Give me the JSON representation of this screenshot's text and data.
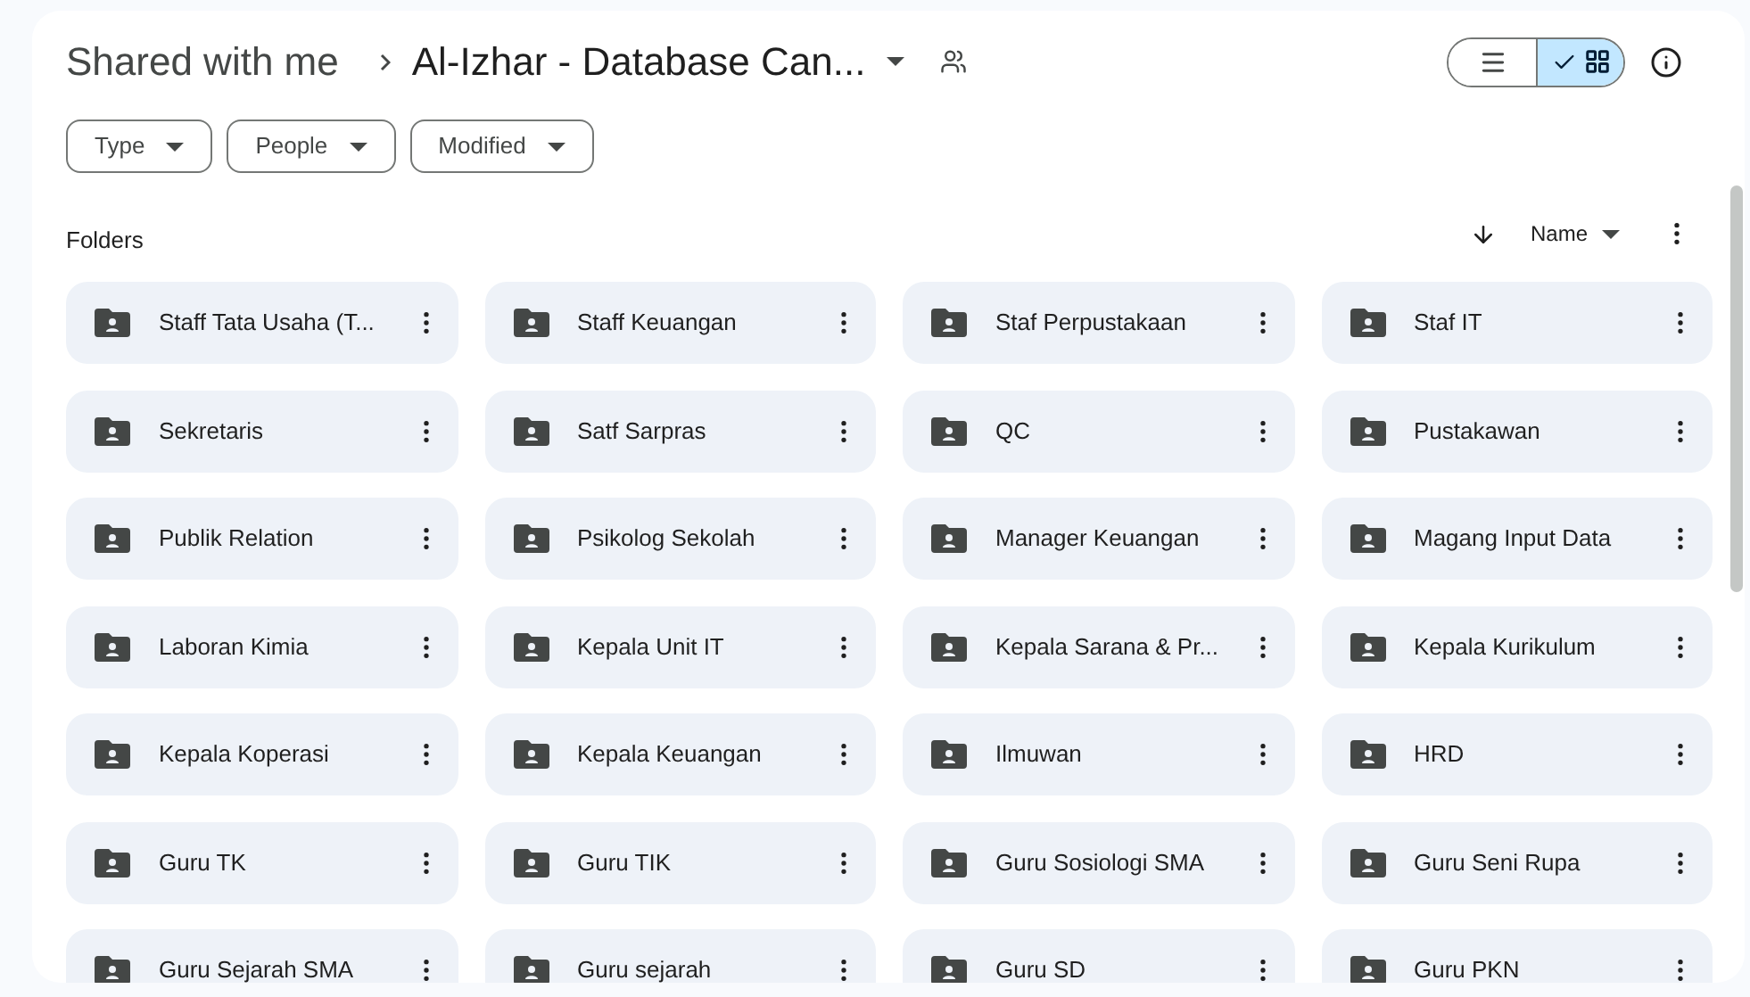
{
  "breadcrumb": [
    {
      "label": "Shared with me"
    },
    {
      "label": "Al-Izhar - Database Can..."
    }
  ],
  "view_toggle": [
    {
      "kind": "list",
      "selected": false
    },
    {
      "kind": "grid",
      "selected": true
    }
  ],
  "filters": [
    {
      "label": "Type"
    },
    {
      "label": "People"
    },
    {
      "label": "Modified"
    }
  ],
  "section_title": "Folders",
  "sort": {
    "label": "Name"
  },
  "folders": [
    {
      "name": "Staff Tata Usaha (T..."
    },
    {
      "name": "Staff Keuangan"
    },
    {
      "name": "Staf Perpustakaan"
    },
    {
      "name": "Staf IT"
    },
    {
      "name": "Sekretaris"
    },
    {
      "name": "Satf Sarpras"
    },
    {
      "name": "QC"
    },
    {
      "name": "Pustakawan"
    },
    {
      "name": "Publik Relation"
    },
    {
      "name": "Psikolog Sekolah"
    },
    {
      "name": "Manager Keuangan"
    },
    {
      "name": "Magang Input Data"
    },
    {
      "name": "Laboran Kimia"
    },
    {
      "name": "Kepala Unit IT"
    },
    {
      "name": "Kepala Sarana & Pr..."
    },
    {
      "name": "Kepala Kurikulum"
    },
    {
      "name": "Kepala Koperasi"
    },
    {
      "name": "Kepala Keuangan"
    },
    {
      "name": "Ilmuwan"
    },
    {
      "name": "HRD"
    },
    {
      "name": "Guru TK"
    },
    {
      "name": "Guru TIK"
    },
    {
      "name": "Guru Sosiologi SMA"
    },
    {
      "name": "Guru Seni Rupa"
    },
    {
      "name": "Guru Sejarah SMA"
    },
    {
      "name": "Guru sejarah"
    },
    {
      "name": "Guru SD"
    },
    {
      "name": "Guru PKN"
    }
  ]
}
